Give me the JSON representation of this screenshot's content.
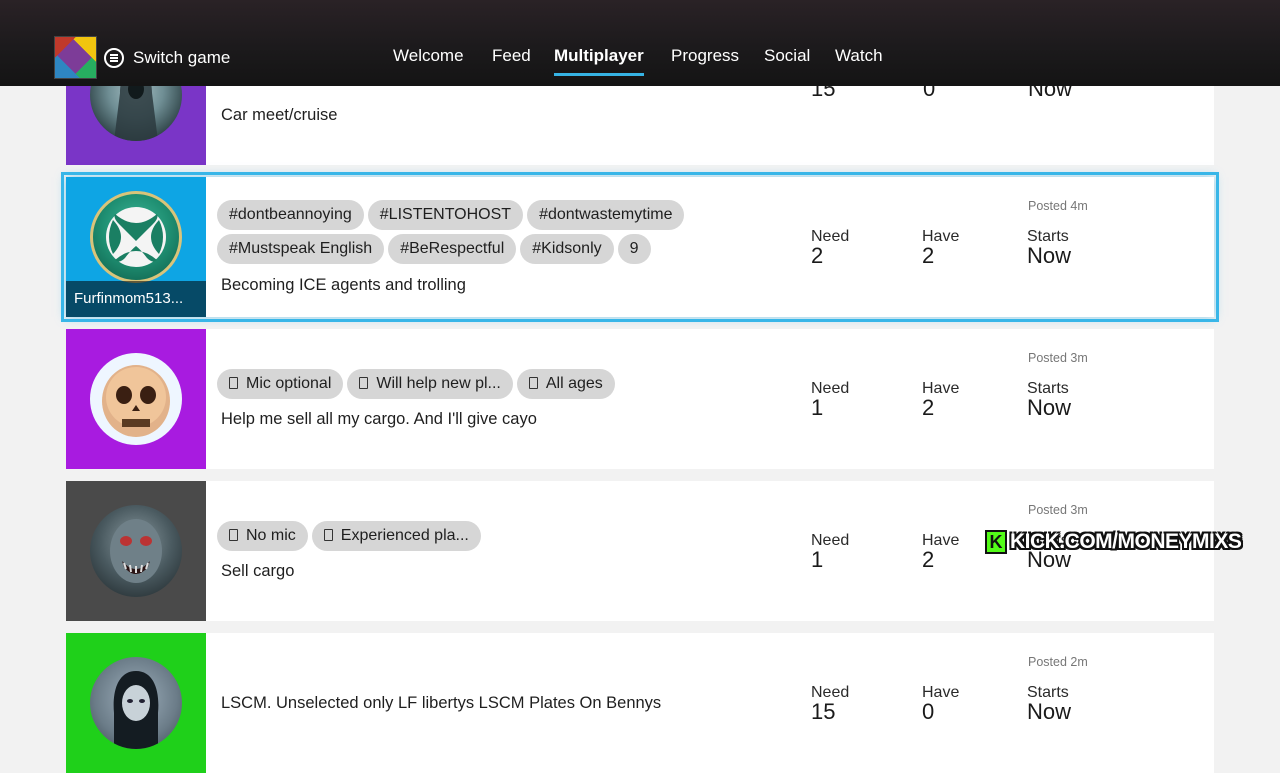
{
  "header": {
    "switch_game_label": "Switch game",
    "tabs": [
      {
        "label": "Welcome",
        "active": false
      },
      {
        "label": "Feed",
        "active": false
      },
      {
        "label": "Multiplayer",
        "active": true
      },
      {
        "label": "Progress",
        "active": false
      },
      {
        "label": "Social",
        "active": false
      },
      {
        "label": "Watch",
        "active": false
      }
    ],
    "accent_color": "#36b3e4"
  },
  "posts": [
    {
      "avatar_color": "#7a35c7",
      "tags": [],
      "description": "Car meet/cruise",
      "need_label": "Need",
      "need": "15",
      "have_label": "Have",
      "have": "0",
      "starts_label": "Starts",
      "starts": "Now",
      "posted": ""
    },
    {
      "avatar_color": "#0ea5e4",
      "gamertag": "Furfinmom513...",
      "tags": [
        "#dontbeannoying",
        "#LISTENTOHOST",
        "#dontwastemytime",
        "#Mustspeak English",
        "#BeRespectful",
        "#Kidsonly",
        "9"
      ],
      "description": "Becoming ICE agents and trolling",
      "need_label": "Need",
      "need": "2",
      "have_label": "Have",
      "have": "2",
      "starts_label": "Starts",
      "starts": "Now",
      "posted": "Posted 4m",
      "selected": true
    },
    {
      "avatar_color": "#a81be0",
      "tags": [
        "Mic optional",
        "Will help new pl...",
        "All ages"
      ],
      "description": "Help me sell all my cargo. And I'll give cayo",
      "need_label": "Need",
      "need": "1",
      "have_label": "Have",
      "have": "2",
      "starts_label": "Starts",
      "starts": "Now",
      "posted": "Posted 3m"
    },
    {
      "avatar_color": "#4a4a4a",
      "tags": [
        "No mic",
        "Experienced pla..."
      ],
      "description": "Sell cargo",
      "need_label": "Need",
      "need": "1",
      "have_label": "Have",
      "have": "2",
      "starts_label": "Starts",
      "starts": "Now",
      "posted": "Posted 3m"
    },
    {
      "avatar_color": "#1fd01a",
      "tags": [],
      "description": "LSCM.  Unselected only LF libertys LSCM Plates On Bennys",
      "need_label": "Need",
      "need": "15",
      "have_label": "Have",
      "have": "0",
      "starts_label": "Starts",
      "starts": "Now",
      "posted": "Posted 2m"
    }
  ],
  "watermark": {
    "logo_letter": "K",
    "text": "KICK.COM/MONEYMIXS",
    "logo_color": "#53fc18"
  }
}
